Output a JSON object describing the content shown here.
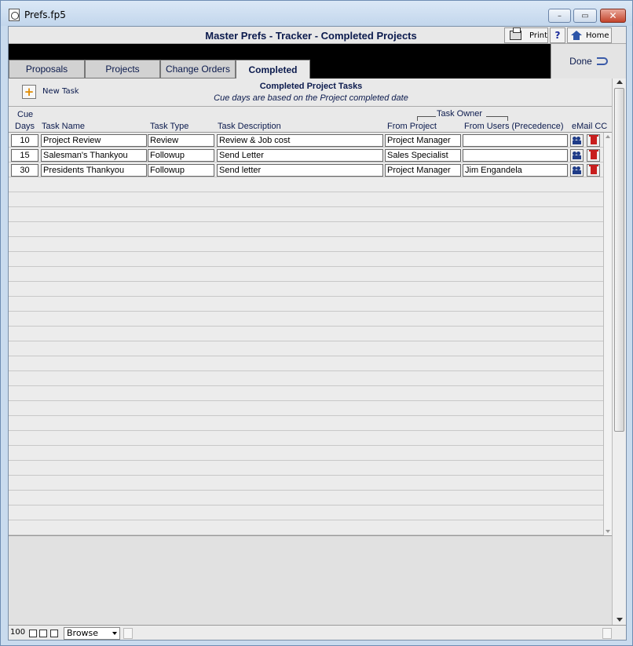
{
  "window": {
    "title": "Prefs.fp5",
    "minimize": "–",
    "maximize": "▭",
    "close": "✕"
  },
  "header": {
    "title": "Master Prefs - Tracker - Completed Projects",
    "print": "Print",
    "help": "?",
    "home": "Home"
  },
  "tabs": [
    {
      "label": "Proposals"
    },
    {
      "label": "Projects"
    },
    {
      "label": "Change Orders"
    },
    {
      "label": "Completed",
      "active": true
    }
  ],
  "done": {
    "label": "Done"
  },
  "subheader": {
    "new_task": "New Task",
    "title": "Completed Project Tasks",
    "note": "Cue days are based on the Project completed date"
  },
  "columns": {
    "cue": "Cue",
    "days": "Days",
    "task_name": "Task Name",
    "task_type": "Task Type",
    "task_description": "Task Description",
    "task_owner": "Task Owner",
    "from_project": "From Project",
    "from_users": "From Users (Precedence)",
    "email_cc": "eMail CC"
  },
  "rows": [
    {
      "days": "10",
      "name": "Project Review",
      "type": "Review",
      "description": "Review & Job cost",
      "from_project": "Project Manager",
      "from_users": ""
    },
    {
      "days": "15",
      "name": "Salesman's Thankyou",
      "type": "Followup",
      "description": "Send Letter",
      "from_project": "Sales Specialist",
      "from_users": ""
    },
    {
      "days": "30",
      "name": "Presidents Thankyou",
      "type": "Followup",
      "description": "Send letter",
      "from_project": "Project Manager",
      "from_users": "Jim Engandela"
    }
  ],
  "status": {
    "zoom": "100",
    "mode": "Browse"
  },
  "colors": {
    "header_text": "#0b1a4d",
    "band": "#000000",
    "close_button": "#c4442c"
  }
}
